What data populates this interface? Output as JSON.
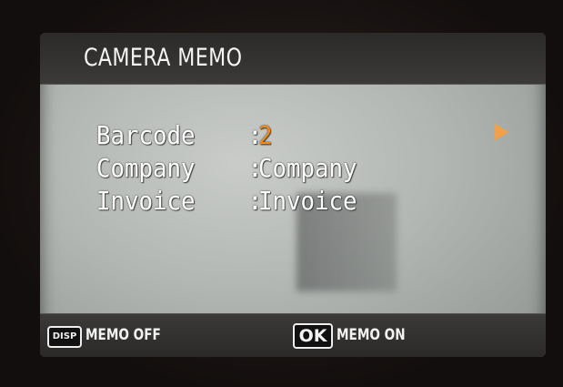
{
  "screen": {
    "title": "CAMERA MEMO"
  },
  "memo_fields": [
    {
      "label": "Barcode",
      "separator": ":",
      "value": "2",
      "selected": true
    },
    {
      "label": "Company",
      "separator": ":",
      "value": "Company",
      "selected": false
    },
    {
      "label": "Invoice",
      "separator": ":",
      "value": "Invoice",
      "selected": false
    }
  ],
  "footer": {
    "disp_button": "DISP",
    "disp_action": "MEMO OFF",
    "ok_button": "OK",
    "ok_action": "MEMO ON"
  },
  "icons": {
    "selection_arrow": "arrow-right-icon",
    "disp": "disp-button-icon",
    "ok": "ok-button-icon"
  },
  "colors": {
    "selected_value": "#f08a1e",
    "arrow": "#f2a14a",
    "text": "#ffffff",
    "bars": "#333231"
  }
}
